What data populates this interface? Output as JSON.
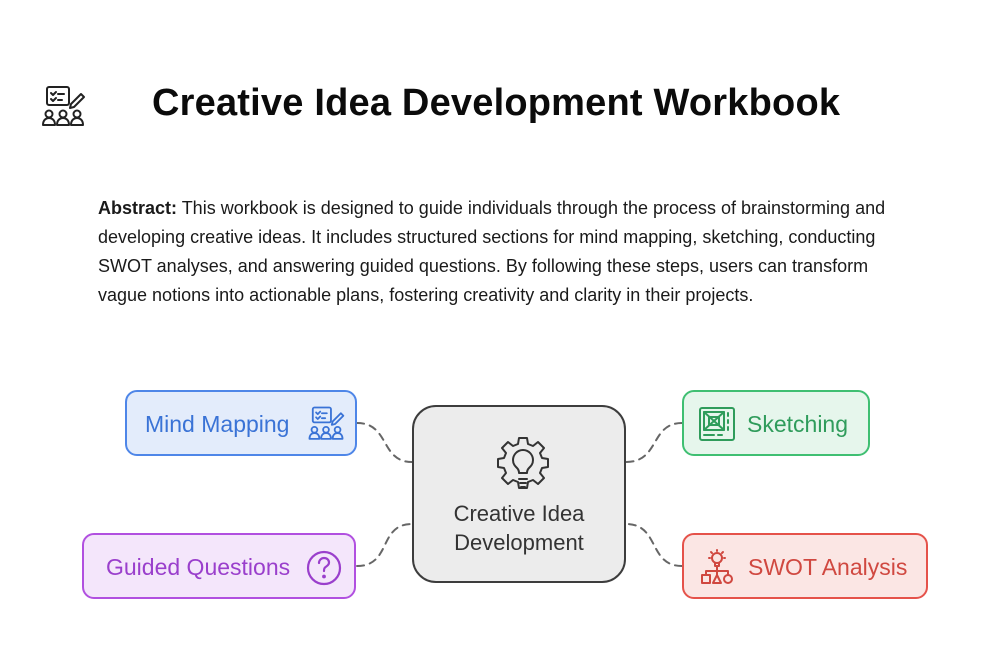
{
  "header": {
    "title": "Creative Idea Development Workbook",
    "icon": "brainstorm-group-icon"
  },
  "abstract": {
    "label": "Abstract:",
    "text": " This workbook is designed to guide individuals through the process of brainstorming and developing creative ideas. It includes structured sections for mind mapping, sketching, conducting SWOT analyses, and answering guided questions. By following these steps, users can transform vague notions into actionable plans, fostering creativity and clarity in their projects."
  },
  "diagram": {
    "center": {
      "line1": "Creative Idea",
      "line2": "Development",
      "icon": "gear-lightbulb-icon"
    },
    "nodes": {
      "mind_mapping": {
        "label": "Mind Mapping",
        "icon": "brainstorm-group-icon",
        "color": "#4e86e8"
      },
      "sketching": {
        "label": "Sketching",
        "icon": "sketch-board-icon",
        "color": "#3fbf72"
      },
      "guided_questions": {
        "label": "Guided Questions",
        "icon": "question-circle-icon",
        "color": "#b150e0"
      },
      "swot_analysis": {
        "label": "SWOT Analysis",
        "icon": "idea-hierarchy-icon",
        "color": "#e5524a"
      }
    }
  }
}
